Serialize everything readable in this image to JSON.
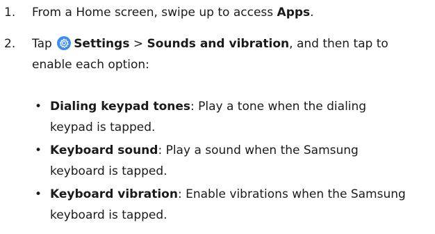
{
  "steps": [
    {
      "number": "1.",
      "text_before": "From a Home screen, swipe up to access ",
      "bold": "Apps",
      "text_after": "."
    },
    {
      "number": "2.",
      "tap": "Tap ",
      "icon": "settings-gear-icon",
      "settings": "Settings",
      "separator": " > ",
      "sounds": "Sounds and vibration",
      "text_after": ", and then tap to",
      "text_line2": "enable each option:"
    }
  ],
  "bullet_symbol": "•",
  "options": [
    {
      "name": "Dialing keypad tones",
      "description_line1": ": Play a tone when the dialing",
      "description_line2": "keypad is tapped."
    },
    {
      "name": "Keyboard sound",
      "description_line1": ": Play a sound when the Samsung",
      "description_line2": "keyboard is tapped."
    },
    {
      "name": "Keyboard vibration",
      "description_line1": ": Enable vibrations when the Samsung",
      "description_line2": "keyboard is tapped."
    }
  ],
  "colors": {
    "text": "#1a1a1a",
    "icon_background": "#3b8ef0"
  }
}
